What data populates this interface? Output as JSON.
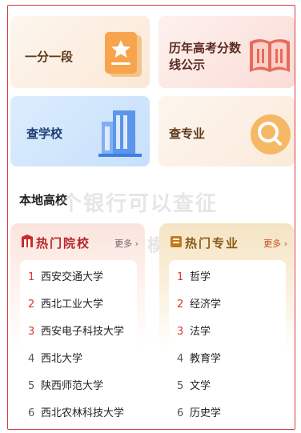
{
  "cards": [
    {
      "id": "one-score",
      "label": "一分一段",
      "icon": "book-star-icon"
    },
    {
      "id": "history-scores",
      "label": "历年高考分数线公示",
      "icon": "open-book-icon"
    },
    {
      "id": "find-school",
      "label": "查学校",
      "icon": "building-icon"
    },
    {
      "id": "find-major",
      "label": "查专业",
      "icon": "magnifier-icon"
    }
  ],
  "local": {
    "title": "本地高校",
    "watermark_line1": "个银行可以查征",
    "watermark_line2": "按以模别鹏"
  },
  "left_list": {
    "title": "热门院校",
    "more": "更多",
    "items": [
      {
        "rank": "1",
        "name": "西安交通大学"
      },
      {
        "rank": "2",
        "name": "西北工业大学"
      },
      {
        "rank": "3",
        "name": "西安电子科技大学"
      },
      {
        "rank": "4",
        "name": "西北大学"
      },
      {
        "rank": "5",
        "name": "陕西师范大学"
      },
      {
        "rank": "6",
        "name": "西北农林科技大学"
      }
    ]
  },
  "right_list": {
    "title": "热门专业",
    "more": "更多",
    "items": [
      {
        "rank": "1",
        "name": "哲学"
      },
      {
        "rank": "2",
        "name": "经济学"
      },
      {
        "rank": "3",
        "name": "法学"
      },
      {
        "rank": "4",
        "name": "教育学"
      },
      {
        "rank": "5",
        "name": "文学"
      },
      {
        "rank": "6",
        "name": "历史学"
      }
    ]
  },
  "colors": {
    "accent_red": "#d8362c",
    "frame": "#d83a3a"
  }
}
